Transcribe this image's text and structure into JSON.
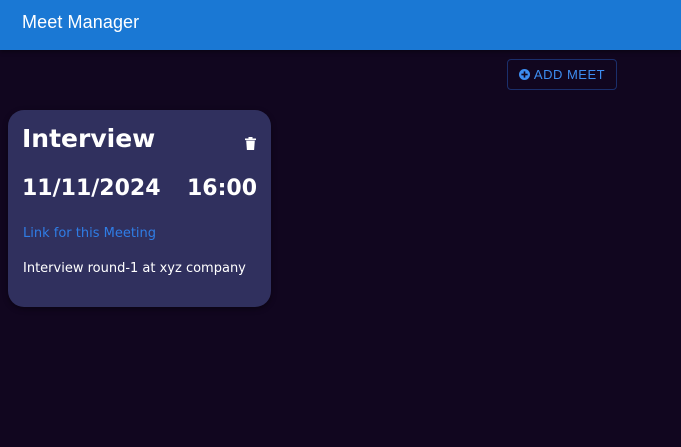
{
  "header": {
    "title": "Meet Manager"
  },
  "toolbar": {
    "add_label": "ADD MEET",
    "add_icon": "plus-circle-icon"
  },
  "meetings": [
    {
      "title": "Interview",
      "date": "11/11/2024",
      "time": "16:00",
      "link_label": "Link for this Meeting",
      "description": "Interview round-1 at xyz company",
      "delete_icon": "trash-icon"
    }
  ],
  "colors": {
    "appbar": "#1a78d4",
    "background": "#11061f",
    "card": "#30305e",
    "accent": "#3d8df0"
  }
}
